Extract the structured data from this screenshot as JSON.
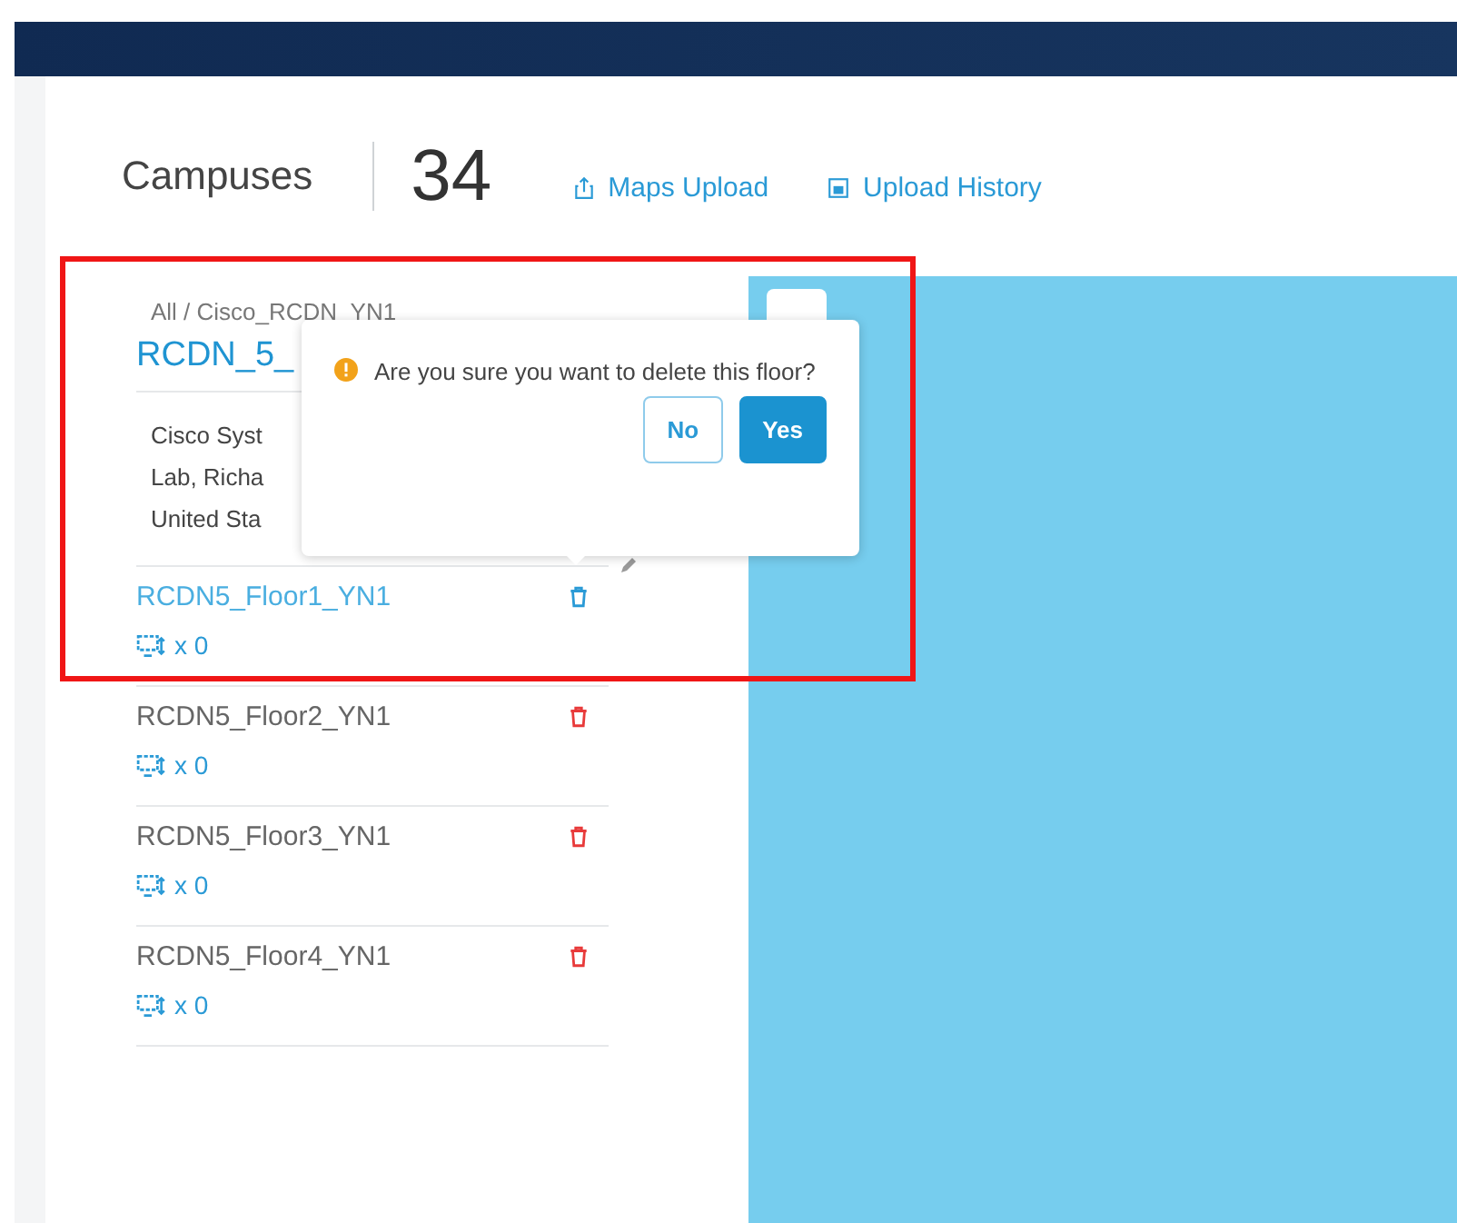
{
  "header": {
    "title": "Campuses",
    "count": "34",
    "actions": [
      {
        "label": "Maps Upload",
        "kind": "upload"
      },
      {
        "label": "Upload History",
        "kind": "history"
      }
    ]
  },
  "site": {
    "breadcrumb": "All / Cisco_RCDN_YN1",
    "name": "RCDN_5_",
    "address": [
      "Cisco Syst",
      "Lab, Richa",
      "United Sta"
    ]
  },
  "floors": [
    {
      "name": "RCDN5_Floor1_YN1",
      "devices": "x 0",
      "selected": true
    },
    {
      "name": "RCDN5_Floor2_YN1",
      "devices": "x 0",
      "selected": false
    },
    {
      "name": "RCDN5_Floor3_YN1",
      "devices": "x 0",
      "selected": false
    },
    {
      "name": "RCDN5_Floor4_YN1",
      "devices": "x 0",
      "selected": false
    }
  ],
  "confirm": {
    "message": "Are you sure you want to delete this floor?",
    "buttons": [
      {
        "label": "No",
        "kind": "secondary"
      },
      {
        "label": "Yes",
        "kind": "primary"
      }
    ]
  }
}
